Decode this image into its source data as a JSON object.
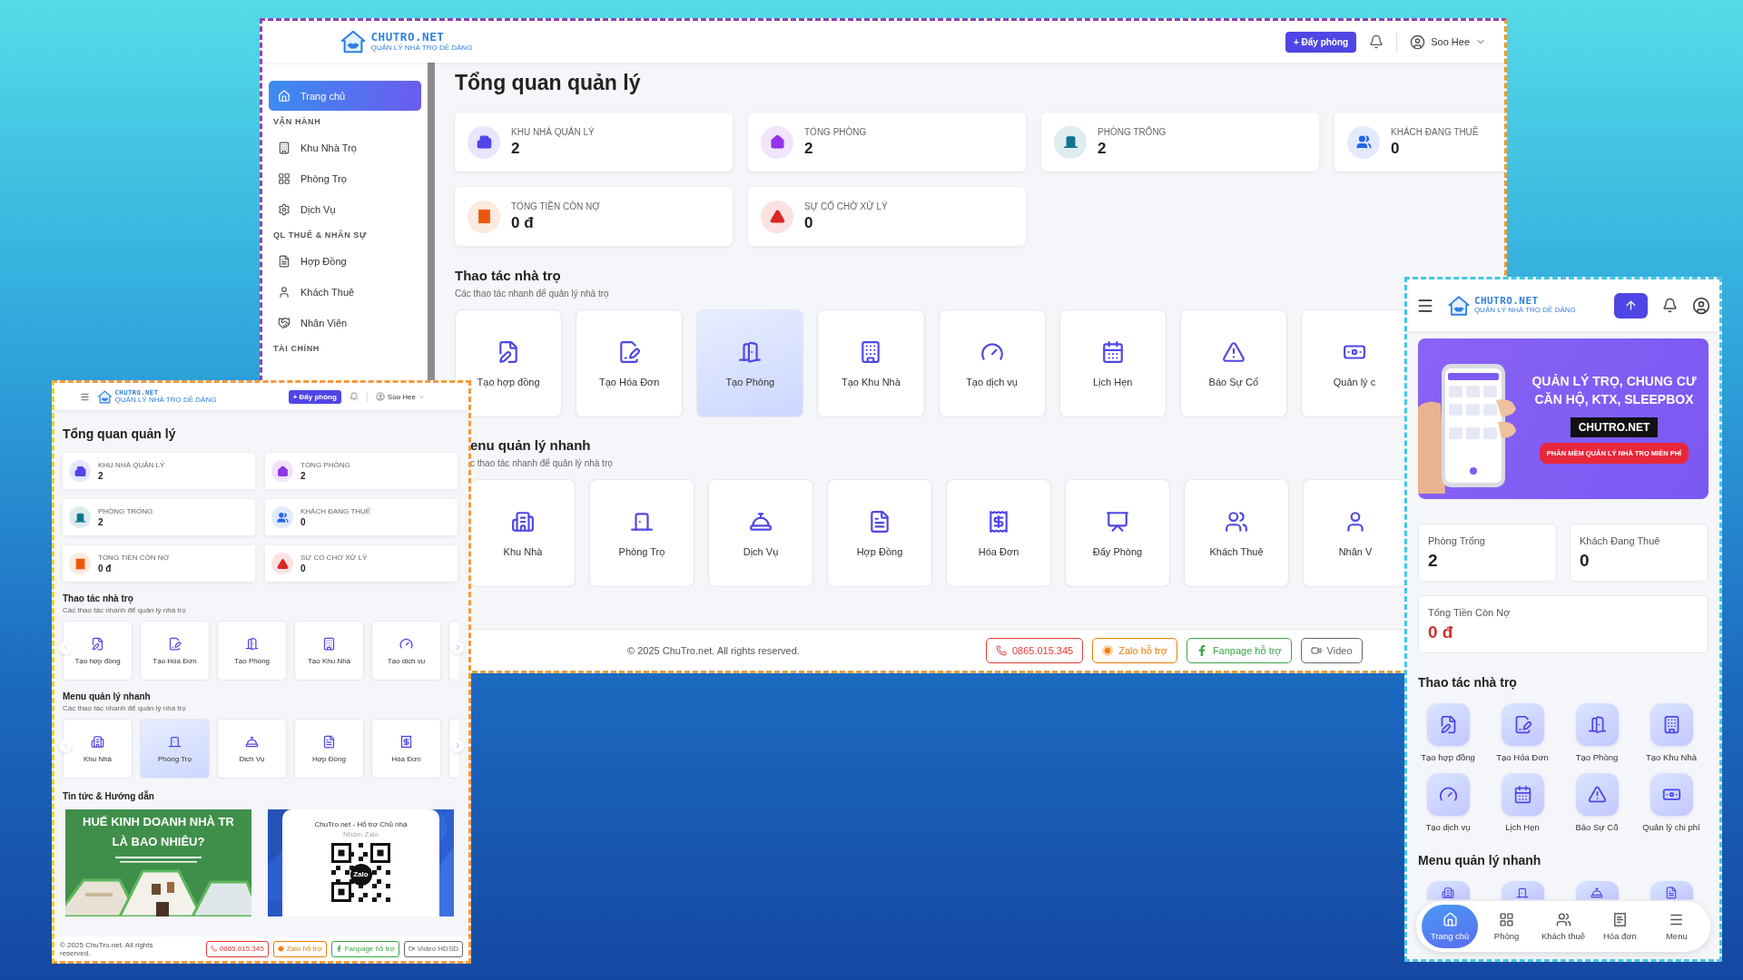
{
  "desktop": {
    "header": {
      "logo": "CHUTRO.NET",
      "tagline": "QUẢN LÝ NHÀ TRỌ DỄ DÀNG",
      "action": "+ Đẩy phòng",
      "user": "Soo Hee"
    },
    "sidebar": [
      {
        "kind": "link",
        "label": "Trang chủ",
        "selected": true
      },
      {
        "kind": "heading",
        "label": "VẬN HÀNH"
      },
      {
        "kind": "link",
        "label": "Khu Nhà Trọ",
        "selected": false
      },
      {
        "kind": "link",
        "label": "Phòng Trọ",
        "selected": false
      },
      {
        "kind": "link",
        "label": "Dịch Vụ",
        "selected": false
      },
      {
        "kind": "heading",
        "label": "QL THUÊ & NHÂN SỰ"
      },
      {
        "kind": "link",
        "label": "Hợp Đồng",
        "selected": false
      },
      {
        "kind": "link",
        "label": "Khách Thuê",
        "selected": false
      },
      {
        "kind": "link",
        "label": "Nhân Viên",
        "selected": false
      },
      {
        "kind": "heading",
        "label": "TÀI CHÍNH"
      }
    ],
    "title": "Tổng quan quản lý",
    "stats": [
      {
        "label": "KHU NHÀ QUẢN LÝ",
        "value": "2",
        "color": "#4f46e5"
      },
      {
        "label": "TỔNG PHÒNG",
        "value": "2",
        "color": "#9333ea"
      },
      {
        "label": "PHÒNG TRỐNG",
        "value": "2",
        "color": "#0e7490"
      },
      {
        "label": "KHÁCH ĐANG THUÊ",
        "value": "0",
        "color": "#2563eb"
      },
      {
        "label": "TỔNG TIỀN CÒN NỢ",
        "value": "0 đ",
        "color": "#ea580c"
      },
      {
        "label": "SỰ CỐ CHỜ XỬ LÝ",
        "value": "0",
        "color": "#dc2626"
      }
    ],
    "sections": [
      {
        "title": "Thao tác nhà trọ",
        "subtitle": "Các thao tác nhanh để quản lý nhà trọ",
        "items": [
          {
            "label": "Tạo hợp đồng",
            "selected": false
          },
          {
            "label": "Tạo Hóa Đơn",
            "selected": false
          },
          {
            "label": "Tạo Phòng",
            "selected": true
          },
          {
            "label": "Tạo Khu Nhà",
            "selected": false
          },
          {
            "label": "Tạo dịch vụ",
            "selected": false
          },
          {
            "label": "Lịch Hẹn",
            "selected": false
          },
          {
            "label": "Báo Sự Cố",
            "selected": false
          },
          {
            "label": "Quản lý c",
            "selected": false
          }
        ]
      },
      {
        "title": "enu quản lý nhanh",
        "subtitle": "c thao tác nhanh để quản lý nhà trọ",
        "items": [
          {
            "label": "Khu Nhà",
            "selected": false
          },
          {
            "label": "Phòng Trọ",
            "selected": false
          },
          {
            "label": "Dịch Vụ",
            "selected": false
          },
          {
            "label": "Hợp Đồng",
            "selected": false
          },
          {
            "label": "Hóa Đơn",
            "selected": false
          },
          {
            "label": "Đẩy Phòng",
            "selected": false
          },
          {
            "label": "Khách Thuê",
            "selected": false
          },
          {
            "label": "Nhân V",
            "selected": false
          }
        ]
      }
    ],
    "footer": {
      "copyright": "© 2025 ChuTro.net. All rights reserved.",
      "buttons": [
        {
          "kind": "phone",
          "label": "0865.015.345"
        },
        {
          "kind": "zalo",
          "label": "Zalo hỗ trợ"
        },
        {
          "kind": "facebook",
          "label": "Fanpage hỗ trợ"
        },
        {
          "kind": "video",
          "label": "Video"
        }
      ]
    }
  },
  "tablet": {
    "header": {
      "logo": "CHUTRO.NET",
      "tagline": "QUẢN LÝ NHÀ TRỌ DỄ DÀNG",
      "action": "+ Đẩy phòng",
      "user": "Soo Hee"
    },
    "title": "Tổng quan quản lý",
    "stats": [
      {
        "label": "KHU NHÀ QUẢN LÝ",
        "value": "2",
        "color": "#4f46e5"
      },
      {
        "label": "TỔNG PHÒNG",
        "value": "2",
        "color": "#9333ea"
      },
      {
        "label": "PHÒNG TRỐNG",
        "value": "2",
        "color": "#0e7490"
      },
      {
        "label": "KHÁCH ĐANG THUÊ",
        "value": "0",
        "color": "#2563eb"
      },
      {
        "label": "TỔNG TIỀN CÒN NỢ",
        "value": "0 đ",
        "color": "#ea580c"
      },
      {
        "label": "SỰ CỐ CHỜ XỬ LÝ",
        "value": "0",
        "color": "#dc2626"
      }
    ],
    "sections": [
      {
        "title": "Thao tác nhà trọ",
        "subtitle": "Các thao tác nhanh để quản lý nhà trọ",
        "items": [
          {
            "label": "Tạo hợp đồng",
            "selected": false
          },
          {
            "label": "Tạo Hóa Đơn",
            "selected": false
          },
          {
            "label": "Tạo Phòng",
            "selected": false
          },
          {
            "label": "Tạo Khu Nhà",
            "selected": false
          },
          {
            "label": "Tạo dịch vụ",
            "selected": false
          }
        ]
      },
      {
        "title": "Menu quản lý nhanh",
        "subtitle": "Các thao tác nhanh để quản lý nhà trọ",
        "items": [
          {
            "label": "Khu Nhà",
            "selected": false
          },
          {
            "label": "Phòng Trọ",
            "selected": true
          },
          {
            "label": "Dịch Vụ",
            "selected": false
          },
          {
            "label": "Hợp Đồng",
            "selected": false
          },
          {
            "label": "Hóa Đơn",
            "selected": false
          }
        ]
      }
    ],
    "news": {
      "title": "Tin tức & Hướng dẫn",
      "items": [
        {
          "kind": "banner",
          "lines": [
            "HUẾ KINH DOANH NHÀ TR",
            "LÀ BAO NHIÊU?"
          ]
        },
        {
          "kind": "qr",
          "title": "ChuTro.net - Hỗ trợ Chủ nhà",
          "subtitle": "Nhóm Zalo",
          "badge": "Zalo"
        }
      ]
    },
    "footer": {
      "copyright": "© 2025 ChuTro.net. All rights reserved.",
      "buttons": [
        {
          "kind": "phone",
          "label": "0865.015.345"
        },
        {
          "kind": "zalo",
          "label": "Zalo hỗ trợ"
        },
        {
          "kind": "facebook",
          "label": "Fanpage hỗ trợ"
        },
        {
          "kind": "video",
          "label": "Video HDSD"
        }
      ]
    }
  },
  "mobile": {
    "header": {
      "logo": "CHUTRO.NET",
      "tagline": "QUẢN LÝ NHÀ TRỌ DỄ DÀNG"
    },
    "banner": {
      "lines": [
        "QUẢN LÝ TRỌ, CHUNG CƯ",
        "CĂN HỘ, KTX, SLEEPBOX"
      ],
      "brand": "CHUTRO.NET",
      "tag": "PHẦN MỀM QUẢN LÝ NHÀ TRỌ MIỄN PHÍ"
    },
    "stats": [
      {
        "kind": "count",
        "label": "Phòng Trống",
        "value": "2"
      },
      {
        "kind": "count",
        "label": "Khách Đang Thuê",
        "value": "0"
      },
      {
        "kind": "money",
        "label": "Tổng Tiền Còn Nợ",
        "value": "0 đ"
      }
    ],
    "actions": {
      "title": "Thao tác nhà trọ",
      "items": [
        "Tạo hợp đồng",
        "Tạo Hóa Đơn",
        "Tạo Phòng",
        "Tạo Khu Nhà",
        "Tạo dịch vụ",
        "Lịch Hẹn",
        "Báo Sự Cố",
        "Quản lý chi phí"
      ]
    },
    "menu_title": "Menu quản lý nhanh",
    "nav": [
      {
        "label": "Trang chủ",
        "selected": true
      },
      {
        "label": "Phòng",
        "selected": false
      },
      {
        "label": "Khách thuê",
        "selected": false
      },
      {
        "label": "Hóa đơn",
        "selected": false
      },
      {
        "label": "Menu",
        "selected": false
      }
    ]
  }
}
